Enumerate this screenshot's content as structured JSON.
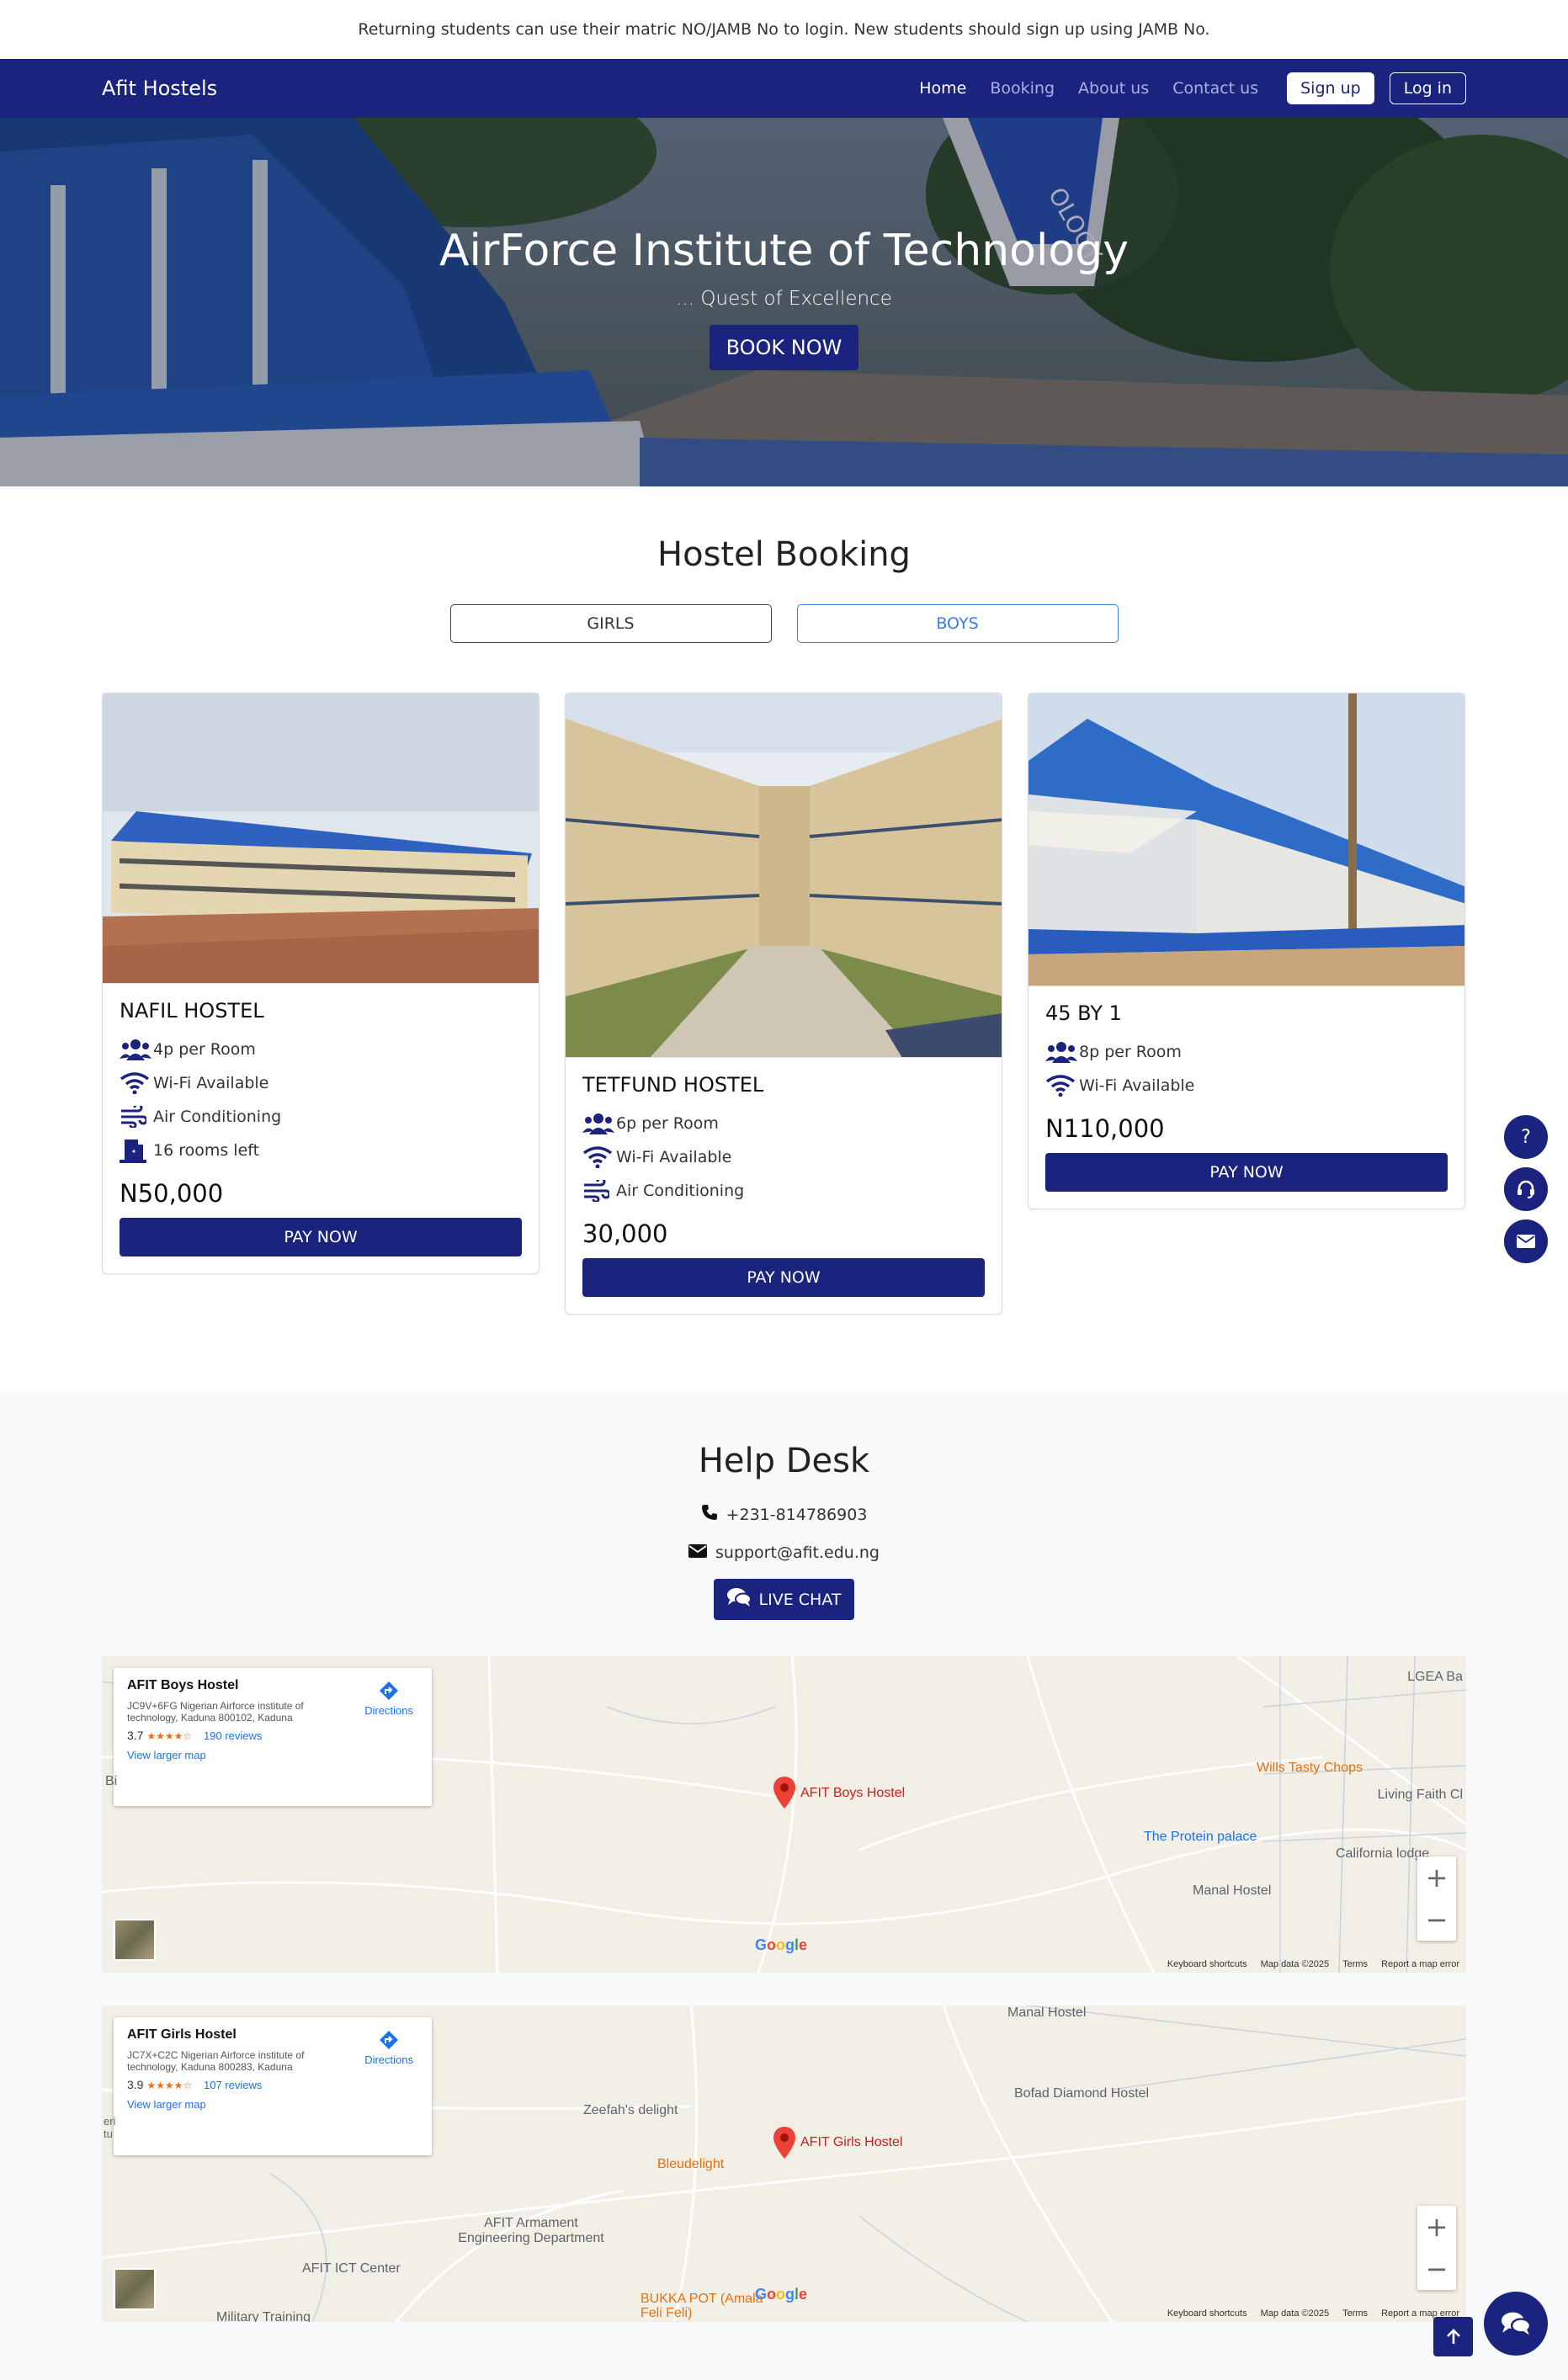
{
  "notice": "Returning students can use their matric NO/JAMB No to login. New students should sign up using JAMB No.",
  "navbar": {
    "brand": "Afit Hostels",
    "links": [
      "Home",
      "Booking",
      "About us",
      "Contact us"
    ],
    "active": "Home",
    "signup": "Sign up",
    "login": "Log in"
  },
  "hero": {
    "title": "AirForce Institute of Technology",
    "subtitle": "... Quest of Excellence",
    "cta": "BOOK NOW",
    "sign_text": "OLOGY"
  },
  "booking": {
    "title": "Hostel Booking",
    "toggle_girls": "GIRLS",
    "toggle_boys": "BOYS",
    "cards": [
      {
        "name": "NAFIL HOSTEL",
        "features": [
          "4p per Room",
          "Wi-Fi Available",
          "Air Conditioning",
          "16 rooms left"
        ],
        "price": "N50,000",
        "pay": "PAY NOW"
      },
      {
        "name": "TETFUND HOSTEL",
        "features": [
          "6p per Room",
          "Wi-Fi Available",
          "Air Conditioning"
        ],
        "price": "30,000",
        "pay": "PAY NOW"
      },
      {
        "name": "45 BY 1",
        "features": [
          "8p per Room",
          "Wi-Fi Available"
        ],
        "price": "N110,000",
        "pay": "PAY NOW"
      }
    ]
  },
  "helpdesk": {
    "title": "Help Desk",
    "phone": "+231-814786903",
    "email": "support@afit.edu.ng",
    "live_chat": "LIVE CHAT"
  },
  "maps": [
    {
      "name": "AFIT Boys Hostel",
      "address": "JC9V+6FG Nigerian Airforce institute of technology, Kaduna 800102, Kaduna",
      "rating": "3.7",
      "stars": "★★★★☆",
      "reviews": "190 reviews",
      "larger": "View larger map",
      "directions": "Directions",
      "pin_label": "AFIT Boys Hostel",
      "labels": {
        "lgea": "LGEA Ba",
        "wills": "Wills Tasty Chops",
        "living": "Living Faith Cl",
        "protein": "The Protein palace",
        "california": "California lodge",
        "manal": "Manal Hostel",
        "edge": "Bi"
      }
    },
    {
      "name": "AFIT Girls Hostel",
      "address": "JC7X+C2C Nigerian Airforce institute of technology, Kaduna 800283, Kaduna",
      "rating": "3.9",
      "stars": "★★★★☆",
      "reviews": "107 reviews",
      "larger": "View larger map",
      "directions": "Directions",
      "pin_label": "AFIT Girls Hostel",
      "labels": {
        "manal": "Manal Hostel",
        "zeefah": "Zeefah's delight",
        "bofad": "Bofad Diamond Hostel",
        "bleudelight": "Bleudelight",
        "armament": "AFIT Armament Engineering Department",
        "ict": "AFIT ICT Center",
        "bukka": "BUKKA POT (Amala Feli Feli)",
        "military": "Military Training",
        "edge": "eri tu"
      }
    }
  ],
  "map_footer": {
    "google": "Google",
    "keyboard": "Keyboard shortcuts",
    "mapdata": "Map data ©2025",
    "terms": "Terms",
    "report": "Report a map error",
    "zoom_in": "+",
    "zoom_out": "−"
  },
  "side_buttons": {
    "question": "?"
  },
  "colors": {
    "primary": "#1a237e",
    "accent_blue": "#3d7be0",
    "helpdesk_bg": "#f8f9fa"
  }
}
